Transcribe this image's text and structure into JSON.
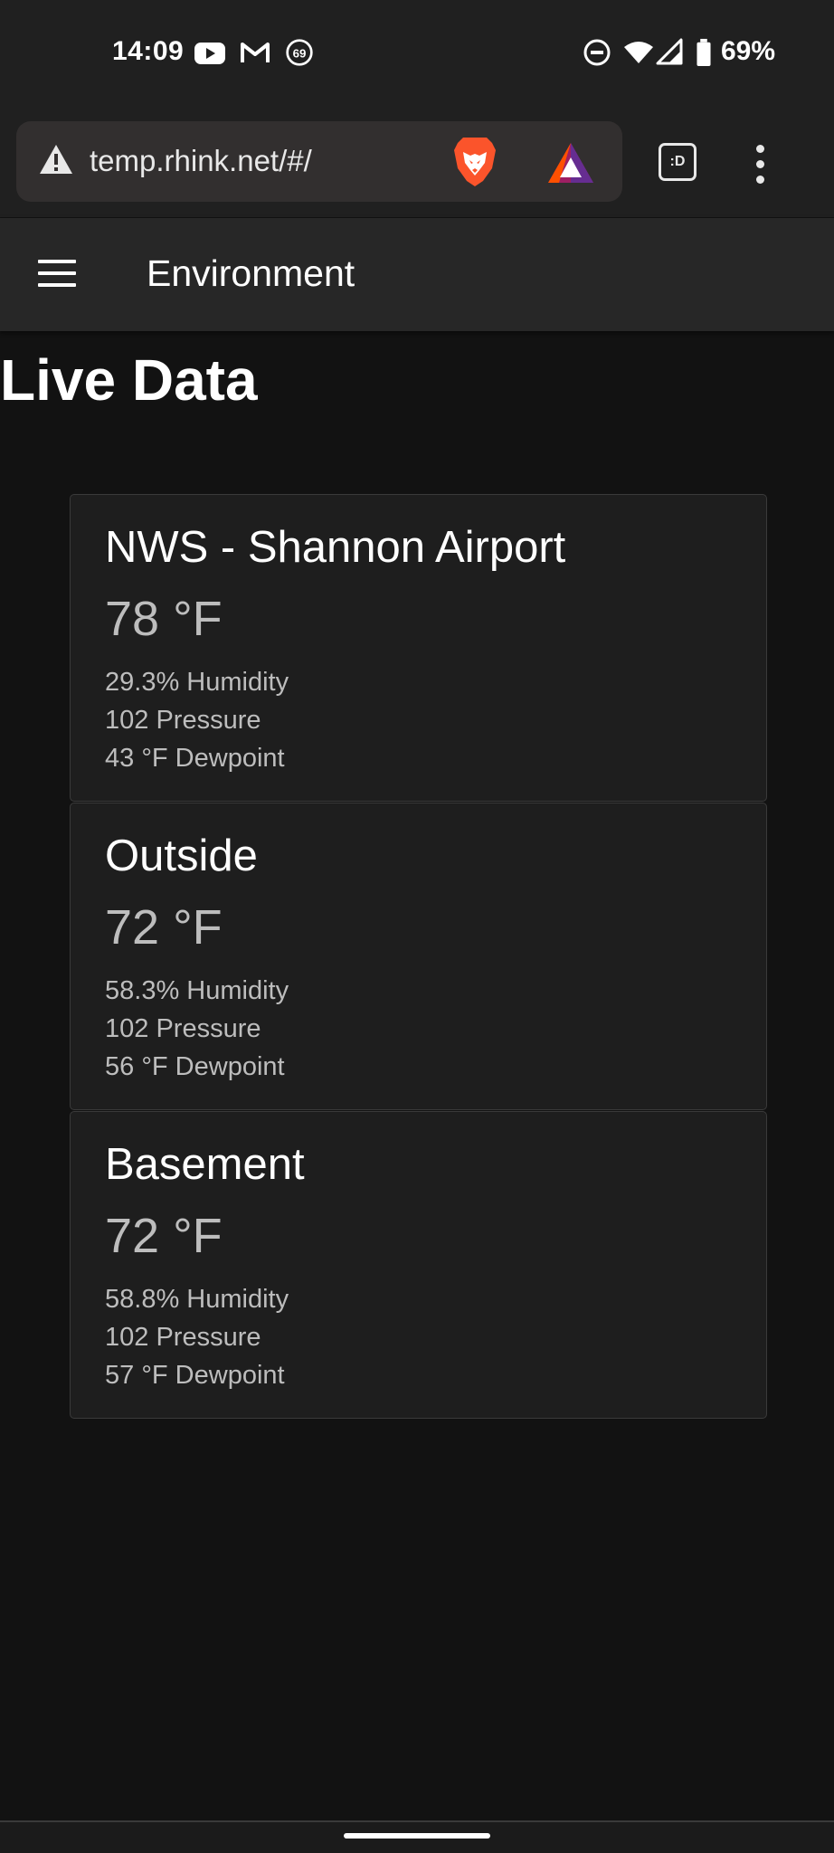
{
  "status_bar": {
    "time": "14:09",
    "battery_percent": "69%",
    "notif_badge": "69",
    "icons": [
      "youtube-icon",
      "gmail-icon",
      "counter-badge-icon",
      "do-not-disturb-icon",
      "wifi-icon",
      "cell-signal-icon",
      "battery-icon"
    ]
  },
  "browser": {
    "url": "temp.rhink.net/#/",
    "tabs_label": ":D",
    "icons": [
      "warning-icon",
      "brave-lion-icon",
      "bat-rewards-icon",
      "menu-dots-icon"
    ]
  },
  "app_bar": {
    "title": "Environment"
  },
  "main": {
    "title": "Live Data",
    "cards": [
      {
        "title": "NWS - Shannon Airport",
        "temperature": "78 °F",
        "humidity": "29.3% Humidity",
        "pressure": "102 Pressure",
        "dewpoint": "43 °F Dewpoint"
      },
      {
        "title": "Outside",
        "temperature": "72 °F",
        "humidity": "58.3% Humidity",
        "pressure": "102 Pressure",
        "dewpoint": "56 °F Dewpoint"
      },
      {
        "title": "Basement",
        "temperature": "72 °F",
        "humidity": "58.8% Humidity",
        "pressure": "102 Pressure",
        "dewpoint": "57 °F Dewpoint"
      }
    ]
  },
  "colors": {
    "background": "#121212",
    "app_bar": "#272727",
    "card": "#1e1e1e",
    "secondary_text": "#bdbdbd",
    "brave_orange": "#fb542b"
  }
}
